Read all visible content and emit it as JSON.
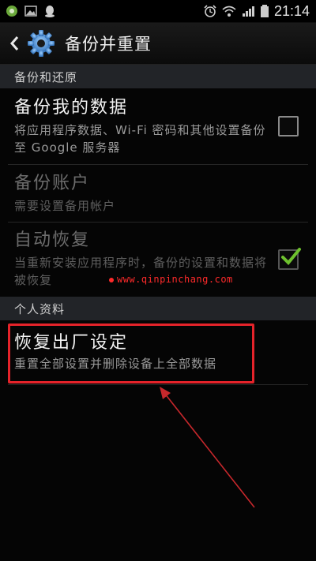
{
  "status_bar": {
    "time": "21:14",
    "icons_left": [
      "app-badge-icon",
      "image-icon",
      "qq-icon"
    ],
    "icons_right": [
      "alarm-icon",
      "wifi-icon",
      "signal-icon",
      "battery-icon"
    ]
  },
  "action_bar": {
    "title": "备份并重置",
    "icon": "gear-icon"
  },
  "sections": {
    "backup": "备份和还原",
    "personal": "个人资料"
  },
  "items": {
    "backup_data": {
      "title": "备份我的数据",
      "summary": "将应用程序数据、Wi-Fi 密码和其他设置备份至 Google 服务器",
      "checked": false
    },
    "backup_account": {
      "title": "备份账户",
      "summary": "需要设置备用帐户"
    },
    "auto_restore": {
      "title": "自动恢复",
      "summary": "当重新安装应用程序时，备份的设置和数据将被恢复",
      "checked": true
    },
    "factory_reset": {
      "title": "恢复出厂设定",
      "summary": "重置全部设置并删除设备上全部数据"
    }
  },
  "watermark": "www.qinpinchang.com",
  "colors": {
    "highlight": "#e5232a",
    "check_green": "#6ec12e",
    "section_bg": "#222428"
  }
}
